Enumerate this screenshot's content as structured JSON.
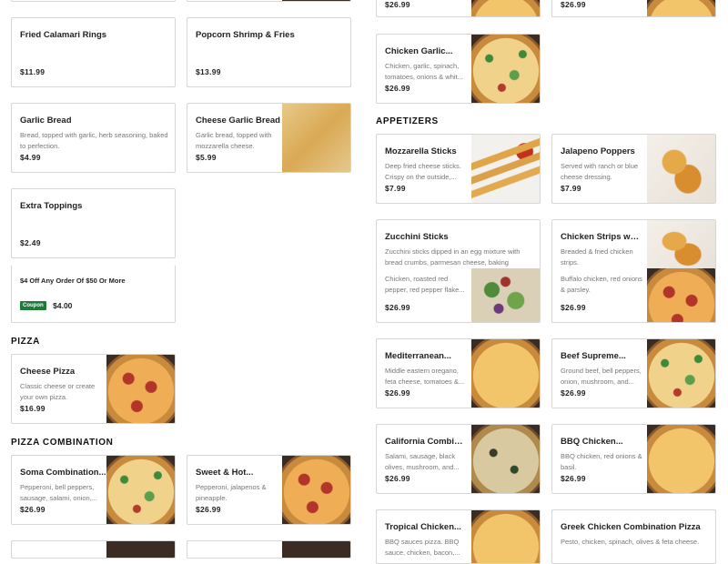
{
  "left_column": {
    "top_cards": [
      {
        "title": "Fried Calamari Rings",
        "price": "$11.99"
      },
      {
        "title": "Popcorn Shrimp & Fries",
        "price": "$13.99"
      }
    ],
    "garlic_bread": {
      "title": "Garlic Bread",
      "desc": "Bread, topped with garlic, herb seasoning, baked to perfection.",
      "price": "$4.99"
    },
    "cheese_garlic_bread": {
      "title": "Cheese Garlic Bread",
      "desc": "Garlic bread, topped with mozzarella cheese.",
      "price": "$5.99"
    },
    "extra_toppings": {
      "title": "Extra Toppings",
      "price": "$2.49"
    },
    "coupon": {
      "title": "$4 Off Any Order Of $50 Or More",
      "badge": "Coupon",
      "price": "$4.00"
    },
    "pizza_section": "PIZZA",
    "cheese_pizza": {
      "title": "Cheese Pizza",
      "desc": "Classic cheese or create your own pizza.",
      "price": "$16.99"
    },
    "combo_section": "PIZZA COMBINATION",
    "soma_combo": {
      "title": "Soma Combination...",
      "desc": "Pepperoni, bell peppers, sausage, salami, onion,...",
      "price": "$26.99"
    },
    "sweet_hot": {
      "title": "Sweet & Hot...",
      "desc": "Pepperoni, jalapenos & pineapple.",
      "price": "$26.99"
    }
  },
  "right_column": {
    "top_prices": [
      "$26.99",
      "$26.99"
    ],
    "chicken_garlic": {
      "title": "Chicken Garlic...",
      "desc": "Chicken, garlic, spinach, tomatoes, onions & whit...",
      "price": "$26.99"
    },
    "appetizers_section": "APPETIZERS",
    "mozzarella": {
      "title": "Mozzarella Sticks",
      "desc": "Deep fried cheese sticks. Crispy on the outside,...",
      "price": "$7.99"
    },
    "jalapeno": {
      "title": "Jalapeno Poppers",
      "desc": "Served with ranch or blue cheese dressing.",
      "price": "$7.99"
    },
    "zucchini": {
      "title": "Zucchini Sticks",
      "desc": "Zucchini sticks dipped in an egg mixture with bread crumbs, parmesan cheese, baking powde..."
    },
    "chicken_strips": {
      "title": "Chicken Strips with...",
      "desc": "Breaded & fried chicken strips."
    },
    "peeking_left": {
      "desc": "Chicken, roasted red pepper, red pepper flake...",
      "price": "$26.99"
    },
    "peeking_right": {
      "desc": "Buffalo chicken, red onions & parsley.",
      "price": "$26.99"
    },
    "mediterranean": {
      "title": "Mediterranean...",
      "desc": "Middle eastern oregano, feta cheese, tomatoes &...",
      "price": "$26.99"
    },
    "beef_supreme": {
      "title": "Beef Supreme...",
      "desc": "Ground beef, bell peppers, onion, mushroom, and...",
      "price": "$26.99"
    },
    "california": {
      "title": "California Combinati...",
      "desc": "Salami, sausage, black olives, mushroom, and...",
      "price": "$26.99"
    },
    "bbq_chicken": {
      "title": "BBQ Chicken...",
      "desc": "BBQ chicken, red onions & basil.",
      "price": "$26.99"
    },
    "tropical": {
      "title": "Tropical Chicken...",
      "desc": "BBQ sauces pizza. BBQ sauce, chicken, bacon,..."
    },
    "greek": {
      "title": "Greek Chicken Combination Pizza",
      "desc": "Pesto, chicken, spinach, olives & feta cheese."
    }
  }
}
